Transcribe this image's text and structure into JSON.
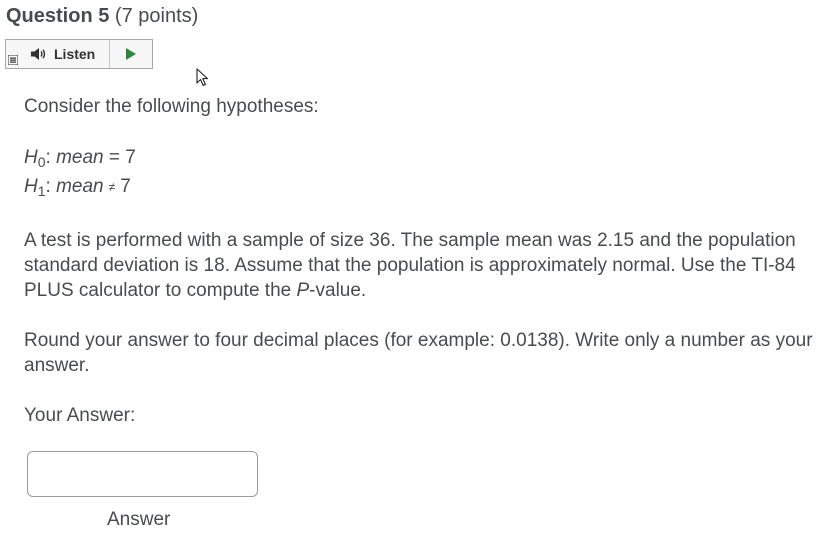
{
  "question": {
    "title": "Question 5",
    "points": "(7 points)"
  },
  "listen": {
    "label": "Listen",
    "menu_icon": "menu-icon",
    "speaker_icon": "speaker-icon",
    "play_icon": "play-icon",
    "play_color": "#2e8540"
  },
  "content": {
    "intro": "Consider the following hypotheses:",
    "h0": {
      "symbol": "H",
      "subscript": "0",
      "colon": ":",
      "variable": "mean",
      "relation": "=",
      "value": "7"
    },
    "h1": {
      "symbol": "H",
      "subscript": "1",
      "colon": ":",
      "variable": "mean",
      "relation": "≠",
      "value": "7"
    },
    "paragraph_before_p": "A test is performed with a sample of size 36. The sample mean was 2.15 and the population standard deviation is 18. Assume that the population is approximately normal. Use the TI-84 PLUS calculator to compute the ",
    "p_letter": "P",
    "paragraph_after_p": "-value.",
    "instructions": "Round your answer to four decimal places (for example: 0.0138). Write only a number as your answer.",
    "answer_prompt": "Your Answer:"
  },
  "answer": {
    "value": "",
    "caption": "Answer"
  }
}
